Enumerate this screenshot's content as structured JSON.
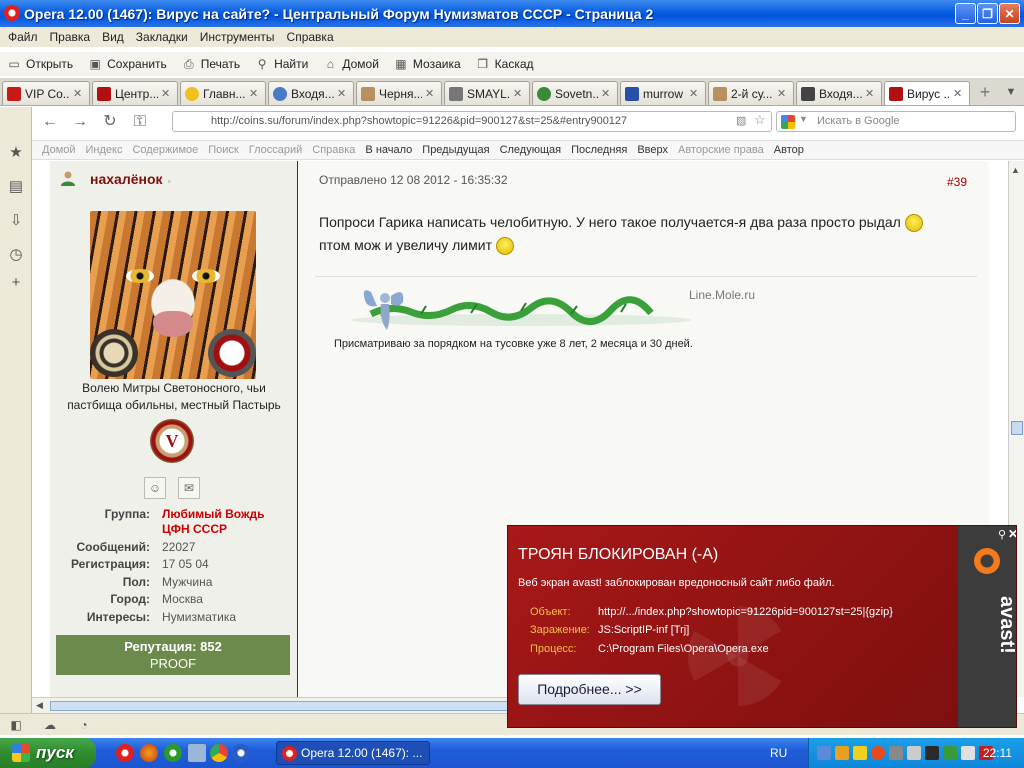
{
  "window": {
    "title": "Opera 12.00 (1467): Вирус на сайте? - Центральный Форум Нумизматов СССР - Страница 2",
    "minimize_label": "_",
    "maximize_label": "❐",
    "close_label": "✕"
  },
  "menubar": {
    "items": [
      "Файл",
      "Правка",
      "Вид",
      "Закладки",
      "Инструменты",
      "Справка"
    ]
  },
  "toolbar": {
    "items": [
      {
        "label": "Открыть",
        "icon": "folder-icon"
      },
      {
        "label": "Сохранить",
        "icon": "save-icon"
      },
      {
        "label": "Печать",
        "icon": "print-icon"
      },
      {
        "label": "Найти",
        "icon": "search-icon"
      },
      {
        "label": "Домой",
        "icon": "home-icon"
      },
      {
        "label": "Мозаика",
        "icon": "tile-icon"
      },
      {
        "label": "Каскад",
        "icon": "cascade-icon"
      }
    ]
  },
  "tabs": [
    {
      "label": "VIP Co...",
      "color": "#c81818",
      "active": false
    },
    {
      "label": "Центр...",
      "color": "#b01010",
      "active": false
    },
    {
      "label": "Главн...",
      "color": "#f0c020",
      "active": false
    },
    {
      "label": "Входя...",
      "color": "#4a7ac8",
      "active": false
    },
    {
      "label": "Черня...",
      "color": "#b89060",
      "active": false
    },
    {
      "label": "SMAYL...",
      "color": "#777777",
      "active": false
    },
    {
      "label": "Sovetn...",
      "color": "#3a8a3a",
      "active": false
    },
    {
      "label": "murrow",
      "color": "#2850a8",
      "active": false
    },
    {
      "label": "2-й су...",
      "color": "#b89060",
      "active": false
    },
    {
      "label": "Входя...",
      "color": "#444444",
      "active": false
    },
    {
      "label": "Вирус ...",
      "color": "#b01010",
      "active": true
    }
  ],
  "navigation": {
    "address": "http://coins.su/forum/index.php?showtopic=91226&pid=900127&st=25&#entry900127",
    "search_placeholder": "Искать в Google"
  },
  "site_nav": {
    "items": [
      {
        "label": "Домой",
        "enabled": false
      },
      {
        "label": "Индекс",
        "enabled": false
      },
      {
        "label": "Содержимое",
        "enabled": false
      },
      {
        "label": "Поиск",
        "enabled": false
      },
      {
        "label": "Глоссарий",
        "enabled": false
      },
      {
        "label": "Справка",
        "enabled": false
      },
      {
        "label": "В начало",
        "enabled": true
      },
      {
        "label": "Предыдущая",
        "enabled": true
      },
      {
        "label": "Следующая",
        "enabled": true
      },
      {
        "label": "Последняя",
        "enabled": true
      },
      {
        "label": "Вверх",
        "enabled": true
      },
      {
        "label": "Авторские права",
        "enabled": false
      },
      {
        "label": "Автор",
        "enabled": true
      }
    ]
  },
  "user": {
    "name": "нахалёнок",
    "title_line1": "Волею Митры Светоносного, чьи",
    "title_line2": "пастбища обильны, местный Пастырь",
    "medal_letter": "V",
    "fields": [
      {
        "label": "Группа:",
        "value": "Любимый Вождь",
        "value2": "ЦФН СССР",
        "highlight": true
      },
      {
        "label": "Сообщений:",
        "value": "22027"
      },
      {
        "label": "Регистрация:",
        "value": "17 05 04"
      },
      {
        "label": "Пол:",
        "value": "Мужчина"
      },
      {
        "label": "Город:",
        "value": "Москва"
      },
      {
        "label": "Интересы:",
        "value": "Нумизматика"
      }
    ],
    "reputation_label": "Репутация: 852",
    "reputation_sub": "PROOF"
  },
  "post": {
    "date": "Отправлено 12 08 2012 - 16:35:32",
    "number": "#39",
    "line1": "Попроси Гарика написать челобитную. У него такое получается-я два раза просто рыдал",
    "line2": "птом мож и увеличу лимит",
    "sig_brand": "Line.Mole.ru",
    "sig_text": "Присматриваю за порядком на тусовке уже 8 лет, 2 месяца и 30 дней."
  },
  "avast": {
    "title": "ТРОЯН БЛОКИРОВАН (-A)",
    "message": "Веб экран avast! заблокирован вредоносный сайт либо файл.",
    "rows": [
      {
        "key": "Объект:",
        "value": "http://.../index.php?showtopic=91226pid=900127st=25|{gzip}"
      },
      {
        "key": "Заражение:",
        "value": "JS:ScriptIP-inf [Trj]"
      },
      {
        "key": "Процесс:",
        "value": "C:\\Program Files\\Opera\\Opera.exe"
      }
    ],
    "button": "Подробнее... >>",
    "brand": "avast!"
  },
  "taskbar": {
    "start": "пуск",
    "task": "Opera 12.00 (1467): ...",
    "lang": "RU",
    "clock": "22:11"
  }
}
